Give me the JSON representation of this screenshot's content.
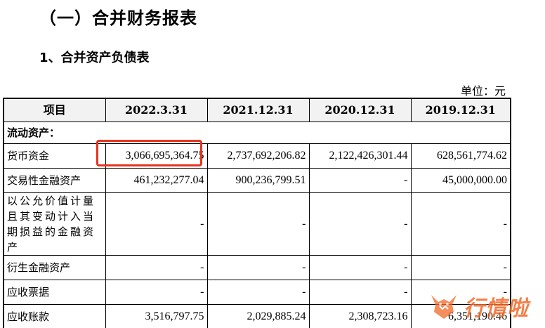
{
  "heading": {
    "section_title": "（一）合并财务报表",
    "sub_title": "1、合并资产负债表",
    "unit_note": "单位：元"
  },
  "table": {
    "headers": [
      "项目",
      "2022.3.31",
      "2021.12.31",
      "2020.12.31",
      "2019.12.31"
    ],
    "category": "流动资产：",
    "rows": [
      {
        "label": "货币资金",
        "values": [
          "3,066,695,364.75",
          "2,737,692,206.82",
          "2,122,426,301.44",
          "628,561,774.62"
        ]
      },
      {
        "label": "交易性金融资产",
        "values": [
          "461,232,277.04",
          "900,236,799.51",
          "-",
          "45,000,000.00"
        ]
      },
      {
        "label": "以公允价值计量且其变动计入当期损益的金融资产",
        "values": [
          "-",
          "-",
          "-",
          "-"
        ]
      },
      {
        "label": "衍生金融资产",
        "values": [
          "-",
          "-",
          "-",
          "-"
        ]
      },
      {
        "label": "应收票据",
        "values": [
          "-",
          "-",
          "-",
          "-"
        ]
      },
      {
        "label": "应收账款",
        "values": [
          "3,516,797.75",
          "2,029,885.24",
          "2,308,723.16",
          "6,351,190.46"
        ]
      }
    ]
  },
  "watermark": {
    "text": "行情啦",
    "icon": "bull-logo-icon",
    "color": "#f26a2a"
  },
  "highlight_color": "#e8331c"
}
